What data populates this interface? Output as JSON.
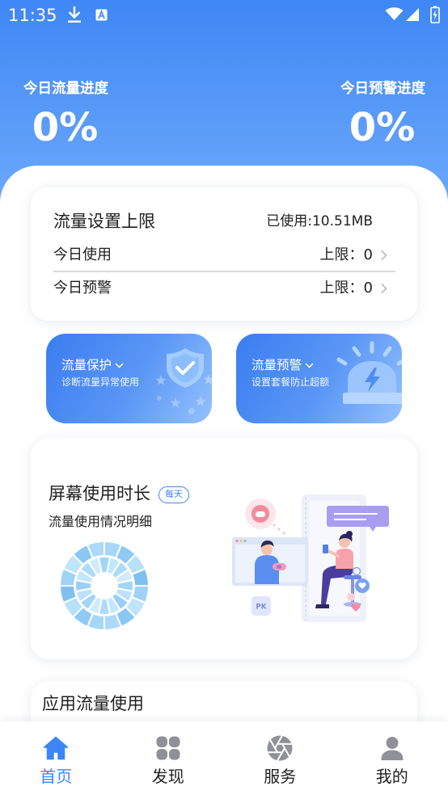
{
  "status_bar": {
    "time": "11:35",
    "left_icons": [
      "download-icon",
      "app-a-icon"
    ],
    "right_icons": [
      "wifi-icon",
      "cell-signal-icon",
      "battery-charging-icon"
    ]
  },
  "header": {
    "traffic_progress": {
      "label": "今日流量进度",
      "value": "0%"
    },
    "warning_progress": {
      "label": "今日预警进度",
      "value": "0%"
    }
  },
  "limit_card": {
    "title": "流量设置上限",
    "used": "已使用:10.51MB",
    "today_usage": {
      "label": "今日使用",
      "value": "上限：0"
    },
    "today_warning": {
      "label": "今日预警",
      "value": "上限：0"
    }
  },
  "feature_cards": [
    {
      "title": "流量保护",
      "subtitle": "诊断流量异常使用",
      "icon": "shield-check-icon"
    },
    {
      "title": "流量预警",
      "subtitle": "设置套餐防止超额",
      "icon": "alarm-light-icon"
    }
  ],
  "screen_time": {
    "title": "屏幕使用时长",
    "badge": "每天",
    "subtitle": "流量使用情况明细",
    "illustration_label": "PK"
  },
  "app_usage": {
    "title": "应用流量使用"
  },
  "bottom_nav": [
    {
      "label": "首页",
      "icon": "home-icon",
      "active": true
    },
    {
      "label": "发现",
      "icon": "discover-grid-icon",
      "active": false
    },
    {
      "label": "服务",
      "icon": "aperture-icon",
      "active": false
    },
    {
      "label": "我的",
      "icon": "user-icon",
      "active": false
    }
  ],
  "colors": {
    "header_top": "#3f87f5",
    "header_bottom": "#6fabfb",
    "primary": "#3d86f4",
    "nav_inactive": "#8e9198",
    "text": "#1f1f1f"
  }
}
